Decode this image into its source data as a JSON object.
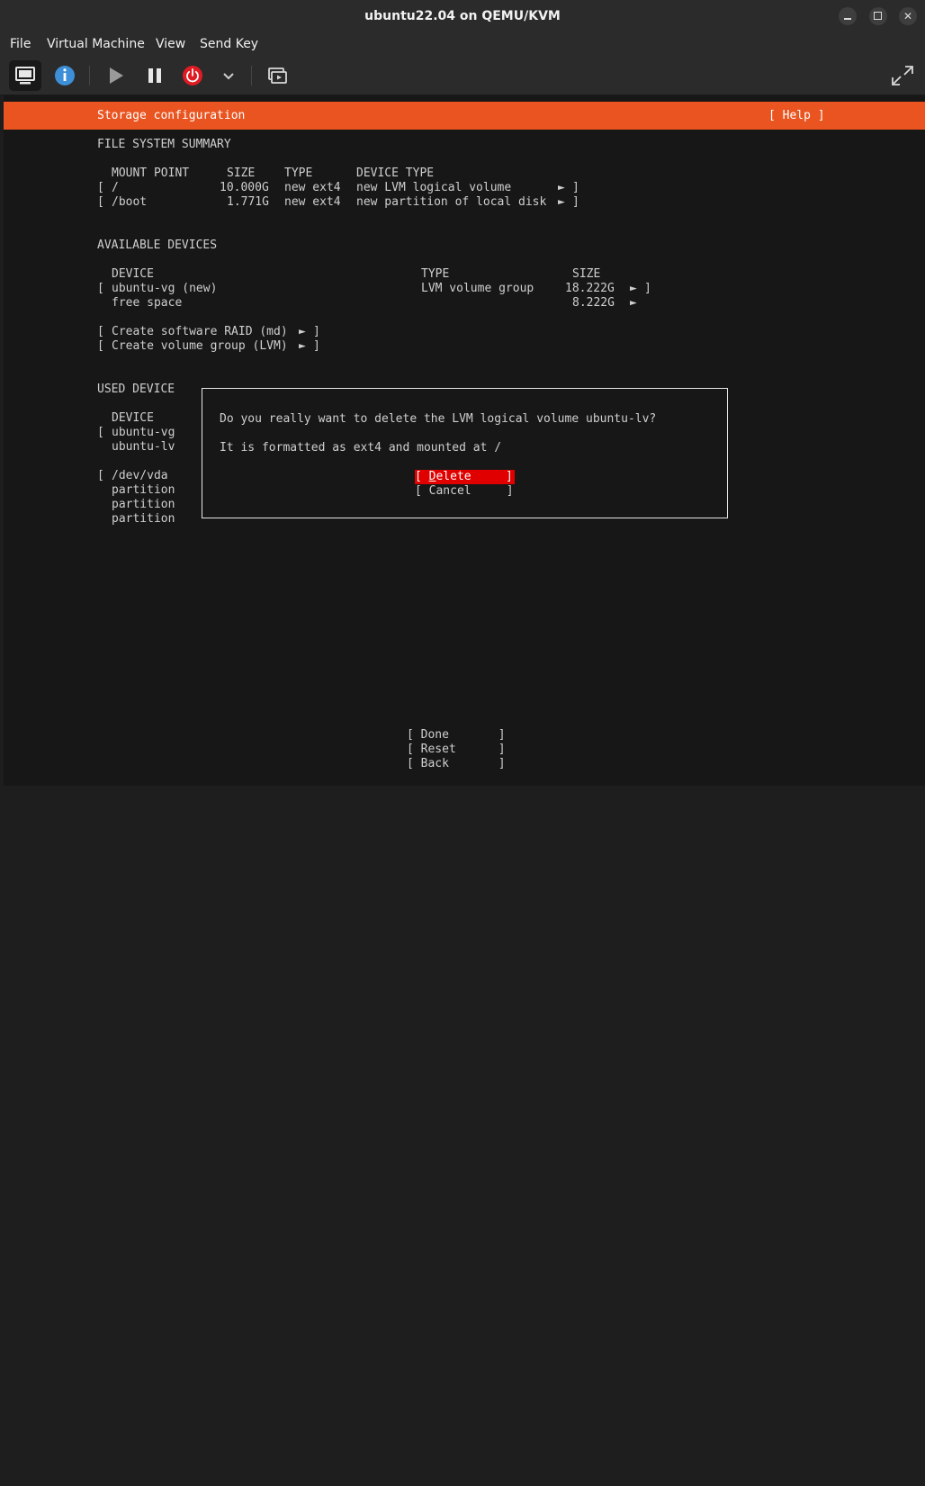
{
  "window": {
    "title": "ubuntu22.04 on QEMU/KVM",
    "controls": [
      "minimize",
      "maximize",
      "close"
    ]
  },
  "menubar": [
    "File",
    "Virtual Machine",
    "View",
    "Send Key"
  ],
  "toolbar": {
    "buttons": [
      "console-icon",
      "info-icon",
      "play-icon",
      "pause-icon",
      "power-icon",
      "chevron-down-icon",
      "screenshot-icon"
    ],
    "right": "fullscreen-icon",
    "colors": {
      "info": "#3d8fd8",
      "power": "#e01b24"
    }
  },
  "installer": {
    "header": "Storage configuration",
    "help": "[ Help ]",
    "accent_color": "#e95420",
    "fs_summary": {
      "heading": "FILE SYSTEM SUMMARY",
      "columns": [
        "MOUNT POINT",
        "SIZE",
        "TYPE",
        "DEVICE TYPE"
      ],
      "rows": [
        {
          "open": "[",
          "mount": "/",
          "size": "10.000G",
          "type": "new ext4",
          "device_type": "new LVM logical volume",
          "arrow": "►",
          "close": "]"
        },
        {
          "open": "[",
          "mount": "/boot",
          "size": "1.771G",
          "type": "new ext4",
          "device_type": "new partition of local disk",
          "arrow": "►",
          "close": "]"
        }
      ]
    },
    "available": {
      "heading": "AVAILABLE DEVICES",
      "columns": [
        "DEVICE",
        "TYPE",
        "SIZE"
      ],
      "rows": [
        {
          "open": "[",
          "device": "ubuntu-vg (new)",
          "type": "LVM volume group",
          "size": "18.222G",
          "arrow": "►",
          "close": "]"
        },
        {
          "open": "",
          "device": "free space",
          "type": "",
          "size": "8.222G",
          "arrow": "►",
          "close": ""
        }
      ],
      "actions": [
        {
          "open": "[",
          "label": "Create software RAID (md)",
          "arrow": "►",
          "close": "]"
        },
        {
          "open": "[",
          "label": "Create volume group (LVM)",
          "arrow": "►",
          "close": "]"
        }
      ]
    },
    "used": {
      "heading": "USED DEVICE",
      "column": "DEVICE",
      "rows": [
        {
          "open": "[",
          "device": "ubuntu-vg"
        },
        {
          "open": "",
          "device": "ubuntu-lv"
        },
        {
          "open": "[",
          "device": "/dev/vda"
        },
        {
          "open": "",
          "device": "partition"
        },
        {
          "open": "",
          "device": "partition"
        },
        {
          "open": "",
          "device": "partition"
        }
      ]
    },
    "dialog": {
      "question": "Do you really want to delete the LVM logical volume ubuntu-lv?",
      "detail": "It is formatted as ext4 and mounted at /",
      "delete": {
        "open": "[ ",
        "hotkey": "D",
        "rest": "elete",
        "close": "]"
      },
      "cancel": "[ Cancel     ]",
      "highlight_color": "#e00000"
    },
    "footer": [
      "[ Done       ]",
      "[ Reset      ]",
      "[ Back       ]"
    ]
  }
}
